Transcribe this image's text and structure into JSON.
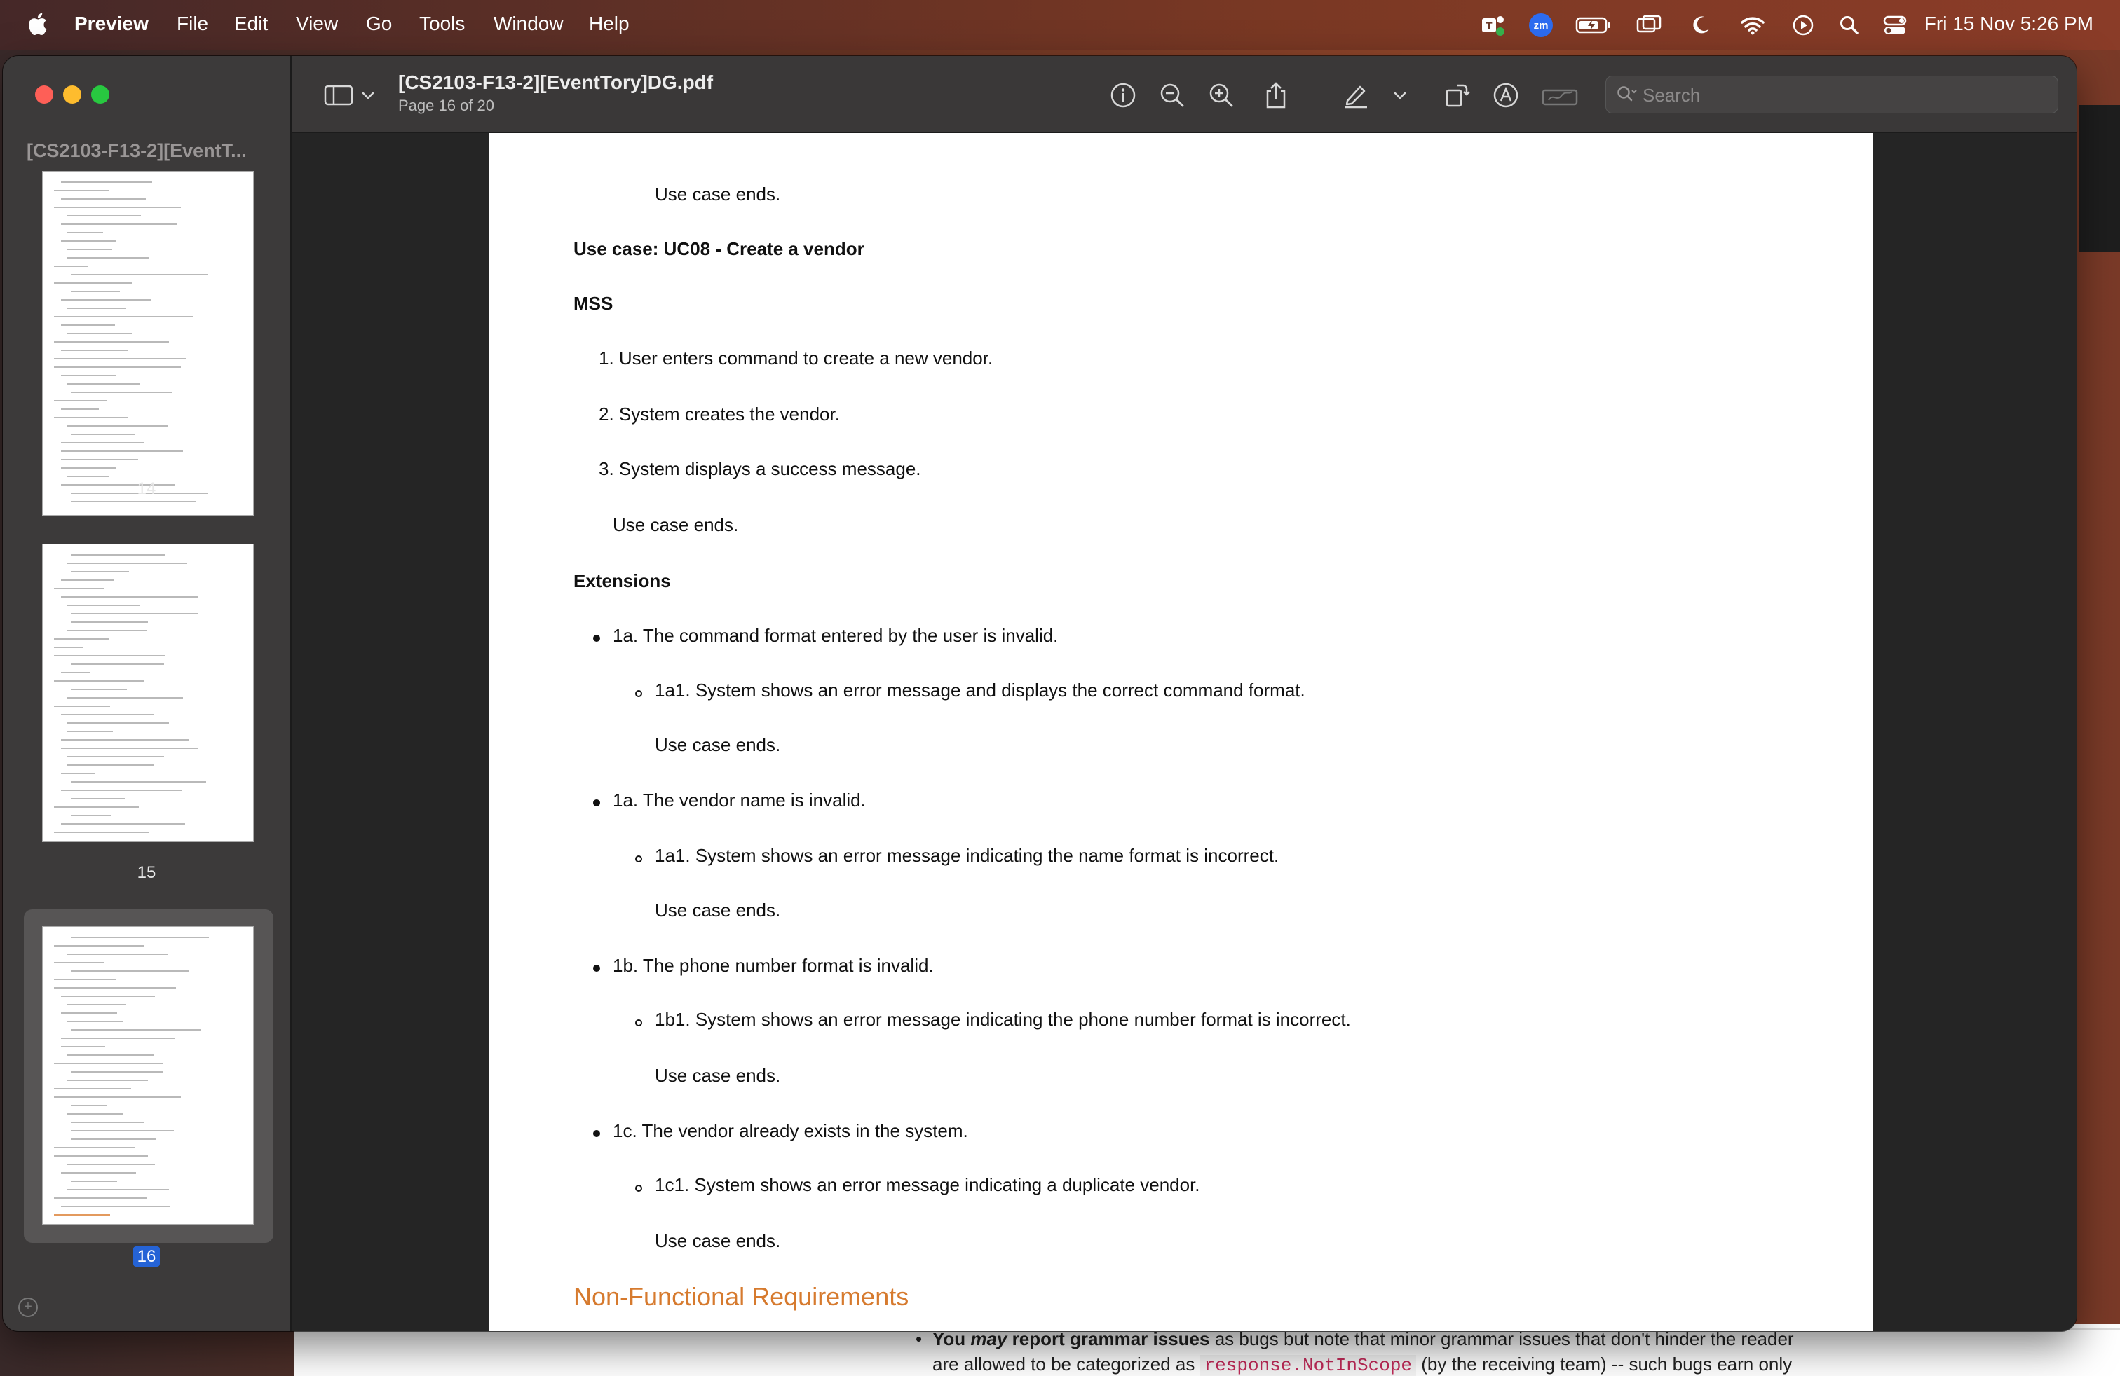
{
  "menubar": {
    "app_name": "Preview",
    "items": [
      "File",
      "Edit",
      "View",
      "Go",
      "Tools",
      "Window",
      "Help"
    ],
    "clock": "Fri 15 Nov  5:26 PM",
    "status_icons": [
      "teams-icon",
      "zoom-icon",
      "battery-icon",
      "screen-mirror-icon",
      "focus-moon-icon",
      "wifi-icon",
      "play-icon",
      "spotlight-search-icon",
      "control-center-icon"
    ],
    "zoom_label": "zm"
  },
  "window": {
    "sidebar_title": "[CS2103-F13-2][EventT...",
    "thumbnails": [
      {
        "label": "14"
      },
      {
        "label": "15"
      },
      {
        "label": "16",
        "selected": true
      }
    ]
  },
  "toolbar": {
    "title": "[CS2103-F13-2][EventTory]DG.pdf",
    "subtitle": "Page 16 of 20",
    "search_placeholder": "Search"
  },
  "document": {
    "top_use_case_ends": "Use case ends.",
    "use_case_title": "Use case: UC08 - Create a vendor",
    "mss_heading": "MSS",
    "mss_steps": [
      "1. User enters command to create a new vendor.",
      "2. System creates the vendor.",
      "3. System displays a success message."
    ],
    "mss_end": "Use case ends.",
    "extensions_heading": "Extensions",
    "extensions": [
      {
        "text": "1a. The command format entered by the user is invalid.",
        "sub": "1a1. System shows an error message and displays the correct command format.",
        "end": "Use case ends."
      },
      {
        "text": "1a. The vendor name is invalid.",
        "sub": "1a1. System shows an error message indicating the name format is incorrect.",
        "end": "Use case ends."
      },
      {
        "text": "1b. The phone number format is invalid.",
        "sub": "1b1. System shows an error message indicating the phone number format is incorrect.",
        "end": "Use case ends."
      },
      {
        "text": "1c. The vendor already exists in the system.",
        "sub": "1c1. System shows an error message indicating a duplicate vendor.",
        "end": "Use case ends."
      }
    ],
    "nfr_heading": "Non-Functional Requirements"
  },
  "background_app": {
    "line1_prefix": "You ",
    "line1_may": "may",
    "line1_bold": " report grammar issues",
    "line1_rest": " as bugs but note that minor grammar issues that don't hinder the reader",
    "line2_a": "are allowed to be categorized as ",
    "line2_code": "response.NotInScope",
    "line2_b": " (by the receiving team) -- such bugs earn only"
  }
}
